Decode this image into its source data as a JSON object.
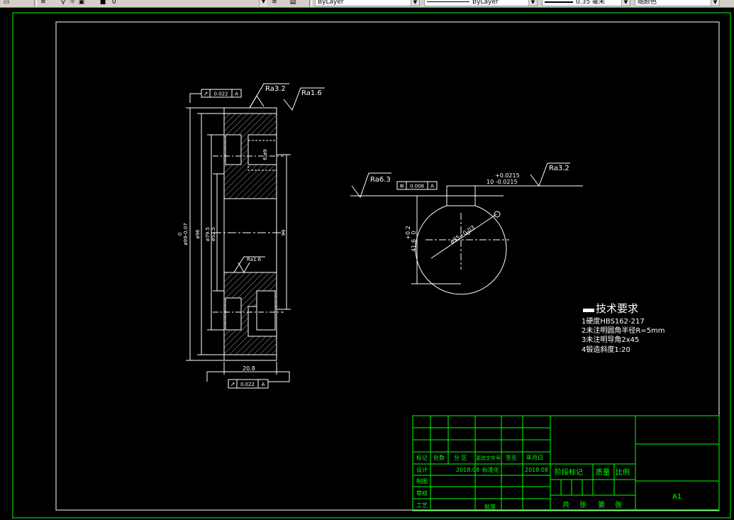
{
  "toolbar": {
    "layer_value": "0",
    "color_value": "ByLayer",
    "linetype_value": "ByLayer",
    "lineweight_value": "0.35 毫米",
    "plotstyle_value": "随颜色"
  },
  "drawing": {
    "surface_top_a": "Ra3.2",
    "surface_top_b": "Ra1.6",
    "surface_hub": "Ra1.6",
    "runout_top_value": "0.022",
    "runout_top_datum": "A",
    "runout_bottom_value": "0.022",
    "runout_bottom_datum": "A",
    "dim_outer_upper": "0",
    "dim_outer": "ø99-0.07",
    "dim_96": "ø96",
    "dim_79_5": "ø79.5",
    "dim_52_5": "ø52.5",
    "dim_99": "99",
    "dim_holes": "6-ø9",
    "dim_width": "20.8",
    "key_ra_left": "Ra6.3",
    "key_symmetry_value": "0.008",
    "key_symmetry_datum": "A",
    "key_ra_right": "Ra3.2",
    "key_width_upper": "+0.0215",
    "key_width": "10 -0.0215",
    "key_depth_upper": "+0.2",
    "key_depth_lower": "0",
    "key_depth": "41.6",
    "bore_dia": "ø35+0.03",
    "bore_dia_lower": "0"
  },
  "notes": {
    "title": "技术要求",
    "items": [
      "1硬度HBS162-217",
      "2未注明圆角半径R=5mm",
      "3未注明导角2x45",
      "4锻造斜度1:20"
    ]
  },
  "title_block": {
    "header_cells": [
      "标记",
      "处数",
      "分 区",
      "更改文件号",
      "签名",
      "年月日"
    ],
    "row_design": [
      "设计",
      "2018.08",
      "标准化",
      "2018.08"
    ],
    "row_draw": "制图",
    "row_review": "审核",
    "row_process": "工艺",
    "row_approve": "批准",
    "stage_label": "阶段标记",
    "mass_label": "质量",
    "scale_label": "比例",
    "sheet_text": [
      "共",
      "张",
      "第",
      "张"
    ],
    "sheet_size": "A1"
  },
  "colors": {
    "background": "#000000",
    "lines": "#ffffff",
    "title_block": "#00ff00",
    "toolbar": "#d4d0c8"
  }
}
